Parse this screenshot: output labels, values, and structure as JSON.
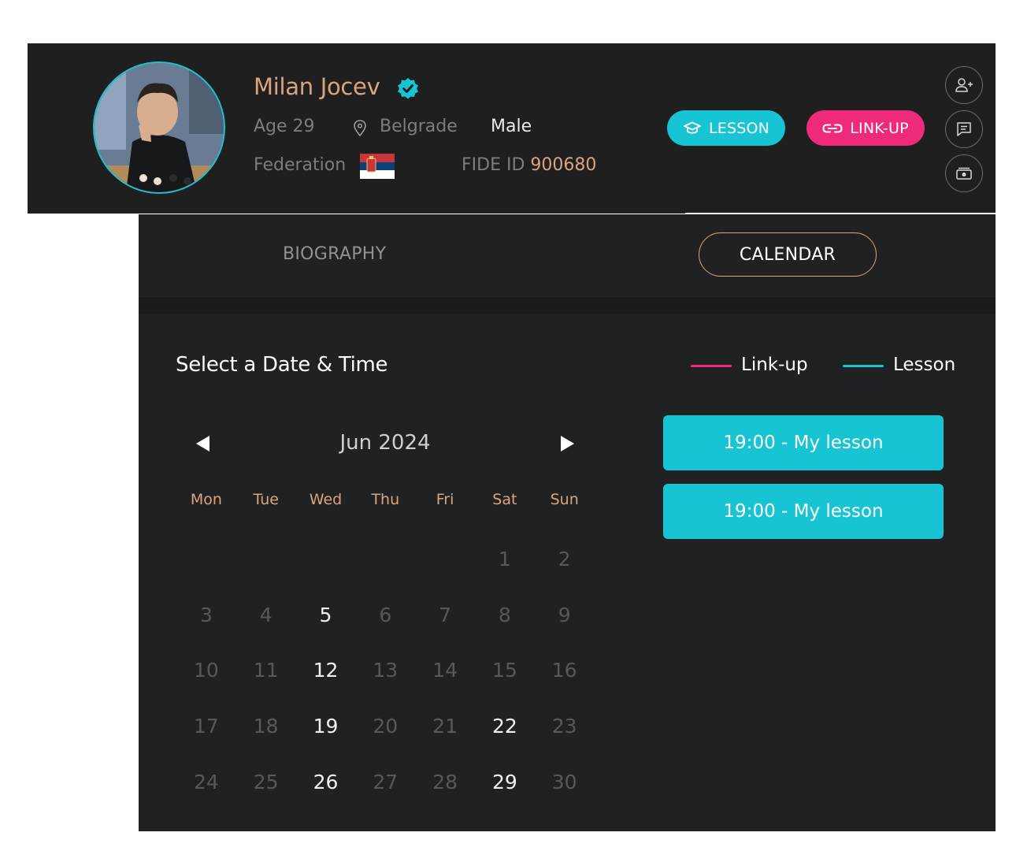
{
  "profile": {
    "name": "Milan Jocev",
    "age": "Age 29",
    "city": "Belgrade",
    "gender": "Male",
    "federation_label": "Federation",
    "fide_label": "FIDE ID",
    "fide_id": "900680",
    "flag": "serbia-flag",
    "avatar": "chess-player-photo"
  },
  "actions": {
    "lesson_label": "LESSON",
    "linkup_label": "LINK-UP",
    "side_icons": [
      "add-friend-icon",
      "message-icon",
      "money-icon"
    ]
  },
  "tabs": [
    {
      "label": "BIOGRAPHY",
      "selected": false
    },
    {
      "label": "CALENDAR",
      "selected": true
    }
  ],
  "calendar": {
    "title": "Select a Date & Time",
    "legend": [
      {
        "label": "Link-up",
        "color": "#ee2a7b"
      },
      {
        "label": "Lesson",
        "color": "#17c4d3"
      }
    ],
    "month": "Jun 2024",
    "weekdays": [
      "Mon",
      "Tue",
      "Wed",
      "Thu",
      "Fri",
      "Sat",
      "Sun"
    ],
    "weeks": [
      [
        "",
        "",
        "",
        "",
        "",
        "1",
        "2"
      ],
      [
        "3",
        "4",
        "5",
        "6",
        "7",
        "8",
        "9"
      ],
      [
        "10",
        "11",
        "12",
        "13",
        "14",
        "15",
        "16"
      ],
      [
        "17",
        "18",
        "19",
        "20",
        "21",
        "22",
        "23"
      ],
      [
        "24",
        "25",
        "26",
        "27",
        "28",
        "29",
        "30"
      ]
    ],
    "available_days": [
      "5",
      "12",
      "19",
      "22",
      "26",
      "29"
    ]
  },
  "slots": [
    {
      "label": "19:00 - My lesson"
    },
    {
      "label": "19:00 - My lesson"
    }
  ],
  "colors": {
    "accent_gold": "#d9a57c",
    "lesson_cyan": "#17c4d3",
    "linkup_pink": "#ee2a7b",
    "background": "#1f1f20"
  }
}
